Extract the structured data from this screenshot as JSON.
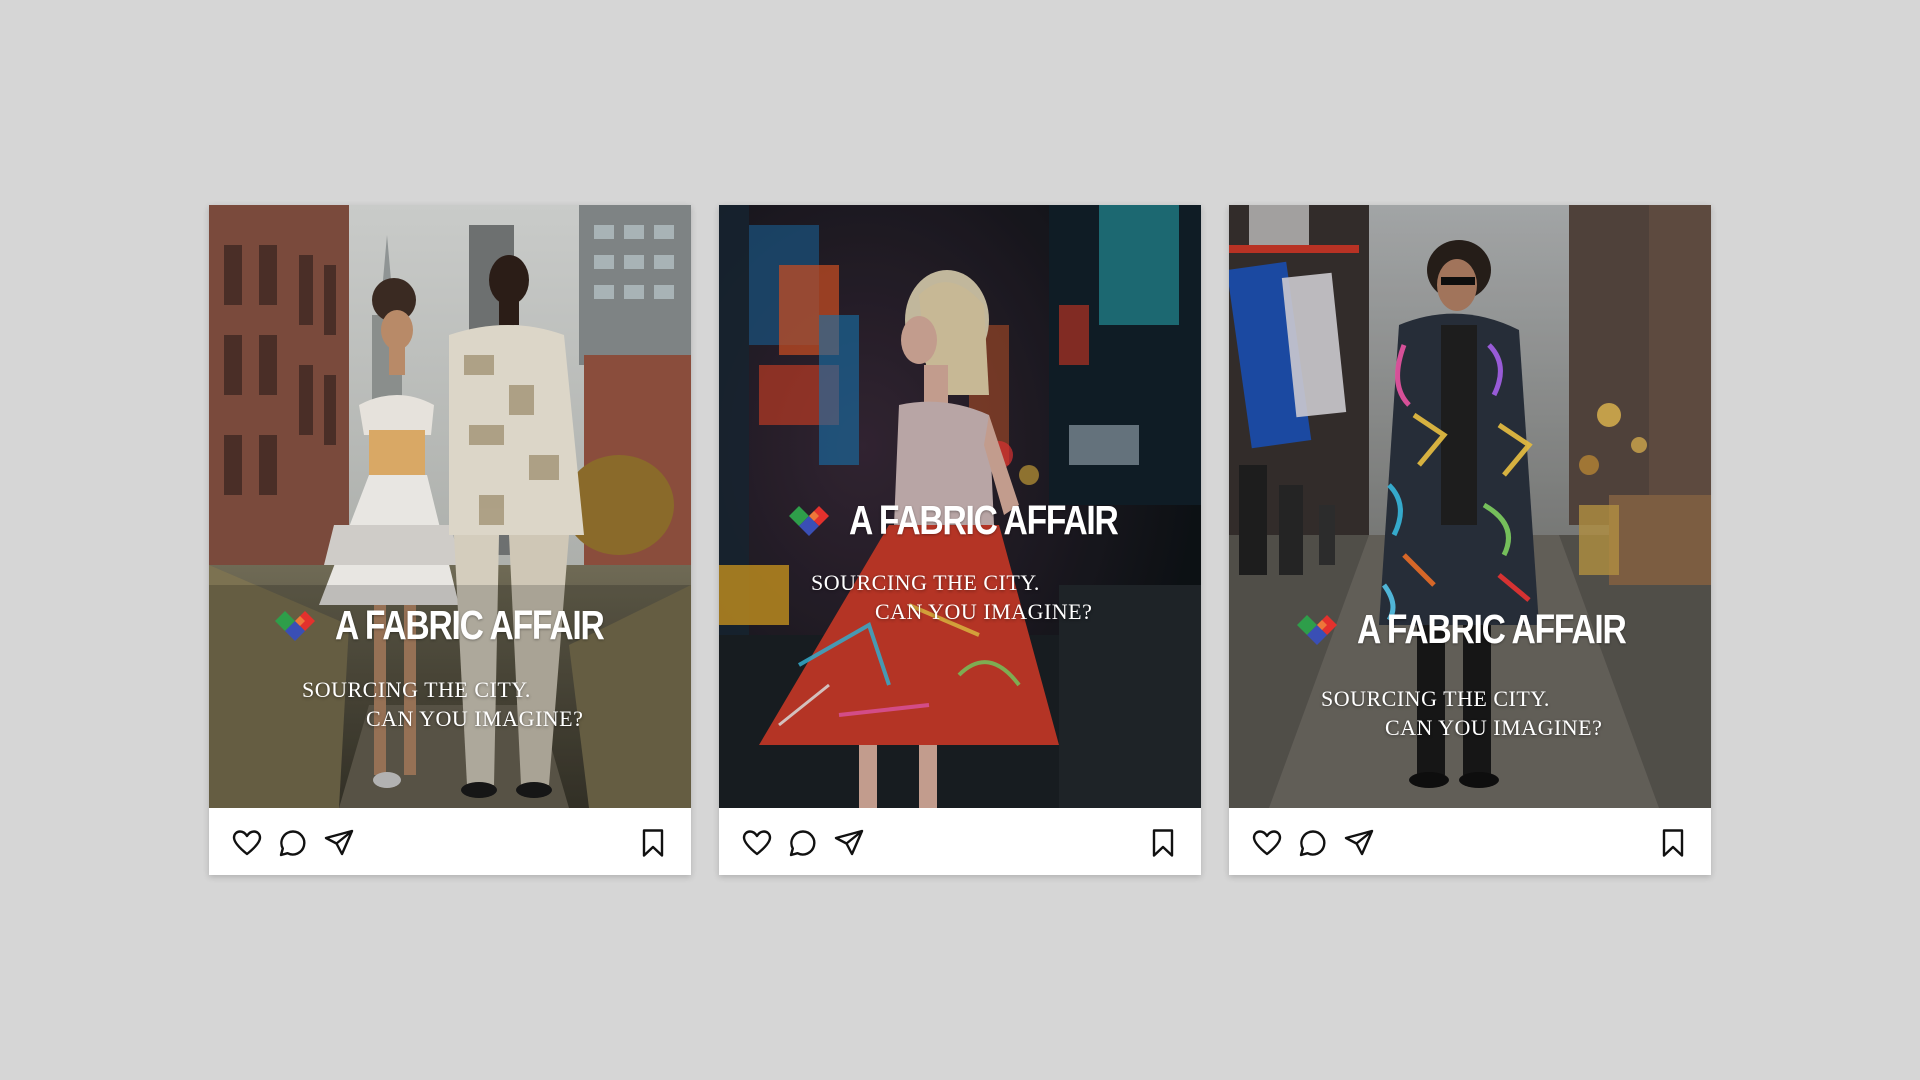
{
  "posts": [
    {
      "brand": "A FABRIC AFFAIR",
      "tagline_line1": "SOURCING THE CITY.",
      "tagline_line2": "CAN YOU IMAGINE?"
    },
    {
      "brand": "A FABRIC AFFAIR",
      "tagline_line1": "SOURCING THE CITY.",
      "tagline_line2": "CAN YOU IMAGINE?"
    },
    {
      "brand": "A FABRIC AFFAIR",
      "tagline_line1": "SOURCING THE CITY.",
      "tagline_line2": "CAN YOU IMAGINE?"
    }
  ],
  "actions": {
    "icons": [
      "heart-icon",
      "comment-icon",
      "share-icon",
      "bookmark-icon"
    ]
  },
  "colors": {
    "background": "#d6d6d6",
    "logo_green": "#2e9e4a",
    "logo_red": "#e3312d",
    "logo_blue": "#3a4fb5",
    "logo_orange": "#f08a3c"
  }
}
